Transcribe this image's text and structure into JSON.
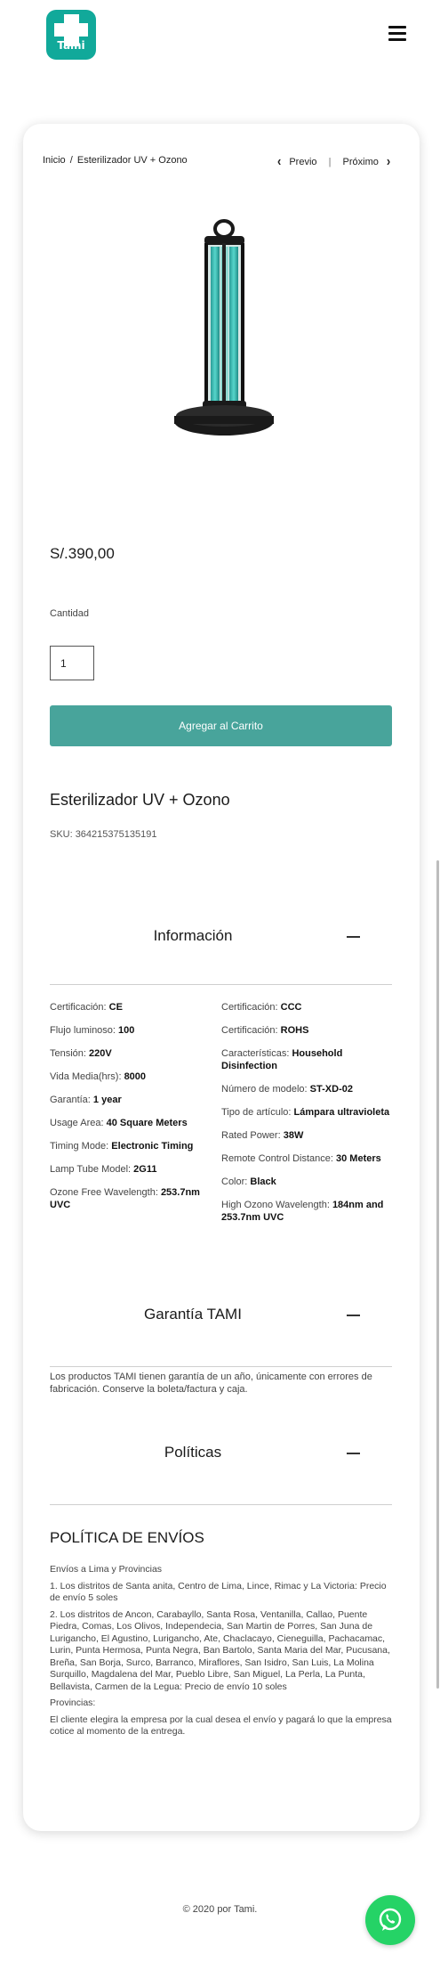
{
  "header": {
    "logo_text": "Tami",
    "brand_color": "#11a99a",
    "menu_icon": "hamburger-menu-icon"
  },
  "breadcrumb": {
    "home": "Inicio",
    "separator": "/",
    "current": "Esterilizador UV + Ozono"
  },
  "pager": {
    "prev": "Previo",
    "next": "Próximo",
    "divider": "|"
  },
  "product": {
    "price": "S/.390,00",
    "quantity_label": "Cantidad",
    "quantity_value": "1",
    "add_to_cart": "Agregar al Carrito",
    "title": "Esterilizador UV + Ozono",
    "sku_label": "SKU:",
    "sku_value": "364215375135191",
    "accent_color": "#48a49b"
  },
  "info_section": {
    "title": "Información",
    "left": [
      {
        "label": "Certificación:",
        "value": "CE"
      },
      {
        "label": "Flujo luminoso:",
        "value": "100"
      },
      {
        "label": "Tensión:",
        "value": "220V"
      },
      {
        "label": "Vida Media(hrs):",
        "value": "8000"
      },
      {
        "label": "Garantía:",
        "value": "1 year"
      },
      {
        "label": "Usage Area:",
        "value": "40 Square Meters"
      },
      {
        "label": "Timing Mode:",
        "value": "Electronic Timing"
      },
      {
        "label": "Lamp Tube Model:",
        "value": "2G11"
      },
      {
        "label": "Ozone Free Wavelength:",
        "value": "253.7nm UVC"
      }
    ],
    "right": [
      {
        "label": "Certificación:",
        "value": "CCC"
      },
      {
        "label": "Certificación:",
        "value": "ROHS"
      },
      {
        "label": "Características:",
        "value": "Household Disinfection"
      },
      {
        "label": "Número de modelo:",
        "value": "ST-XD-02"
      },
      {
        "label": "Tipo de artículo:",
        "value": "Lámpara ultravioleta"
      },
      {
        "label": "Rated Power:",
        "value": "38W"
      },
      {
        "label": "Remote Control Distance:",
        "value": "30 Meters"
      },
      {
        "label": "Color:",
        "value": "Black"
      },
      {
        "label": "High Ozono Wavelength:",
        "value": "184nm and 253.7nm UVC"
      }
    ]
  },
  "warranty_section": {
    "title": "Garantía TAMI",
    "text": "Los productos TAMI tienen garantía de un año, únicamente con errores de fabricación. Conserve la boleta/factura y caja."
  },
  "policies_section": {
    "title": "Políticas",
    "heading": "POLÍTICA DE ENVÍOS",
    "paragraphs": [
      "Envíos a Lima y Provincias",
      "1. Los distritos de Santa anita, Centro de Lima, Lince, Rimac y La Victoria: Precio de envío 5 soles",
      "2. Los distritos de Ancon, Carabayllo, Santa Rosa, Ventanilla, Callao, Puente Piedra, Comas, Los Olivos, Independecia, San Martin de Porres, San Juna de Lurigancho, El Agustino, Lurigancho, Ate, Chaclacayo, Cieneguilla, Pachacamac, Lurin, Punta Hermosa, Punta Negra, Ban Bartolo, Santa Maria del Mar, Pucusana, Breña, San Borja, Surco, Barranco, Miraflores, San Isidro, San Luis, La Molina Surquillo, Magdalena del Mar, Pueblo Libre, San Miguel, La Perla, La Punta, Bellavista, Carmen de la Legua: Precio de envío 10 soles",
      "Provincias:",
      "El cliente elegira la empresa por la cual desea el envío y pagará lo que la empresa cotice al momento de la entrega."
    ]
  },
  "footer": {
    "text": "© 2020 por Tami."
  },
  "whatsapp": {
    "icon": "whatsapp-icon",
    "color": "#25d366"
  }
}
